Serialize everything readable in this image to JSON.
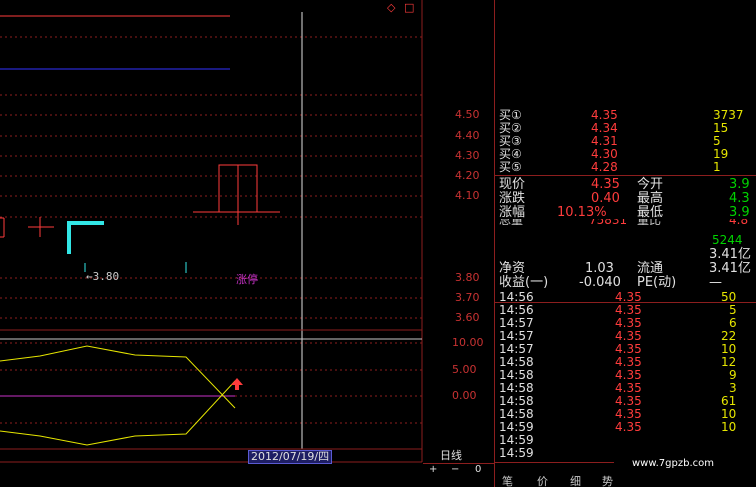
{
  "top_icons": {
    "restore": "◇",
    "window": "□"
  },
  "axis_upper": [
    "4.50",
    "4.40",
    "4.30",
    "4.20",
    "4.10"
  ],
  "axis_lower": [
    "3.80",
    "3.70",
    "3.60"
  ],
  "axis_indicator": [
    "10.00",
    "5.00",
    "0.00"
  ],
  "annotations": {
    "low_marker": "←3.80",
    "limit_up": "涨停"
  },
  "date_label": "2012/07/19/四",
  "period_label": "日线",
  "zoom": {
    "plus": "+",
    "minus": "−",
    "zero": "0"
  },
  "order_book": [
    {
      "label": "买①",
      "price": "4.35",
      "vol": "3737"
    },
    {
      "label": "买②",
      "price": "4.34",
      "vol": "15"
    },
    {
      "label": "买③",
      "price": "4.31",
      "vol": "5"
    },
    {
      "label": "买④",
      "price": "4.30",
      "vol": "19"
    },
    {
      "label": "买⑤",
      "price": "4.28",
      "vol": "1"
    }
  ],
  "stats": [
    {
      "l1": "现价",
      "v1": "4.35",
      "l2": "今开",
      "v2": "3.9"
    },
    {
      "l1": "涨跌",
      "v1": "0.40",
      "l2": "最高",
      "v2": "4.3"
    },
    {
      "l1": "涨幅",
      "v1": "10.13%",
      "l2": "最低",
      "v2": "3.9"
    }
  ],
  "partial_row": {
    "l1": "总量",
    "v1": "75831",
    "l2": "量比",
    "v2": "4.8"
  },
  "volume_right": "5244",
  "capital": [
    {
      "l1": "",
      "v1": "",
      "l2": "",
      "v2": "3.41亿"
    },
    {
      "l1": "净资",
      "v1": "1.03",
      "l2": "流通",
      "v2": "3.41亿"
    },
    {
      "l1": "收益(一)",
      "v1": "-0.040",
      "l2": "PE(动)",
      "v2": "—"
    }
  ],
  "ticks": [
    {
      "time": "14:56",
      "price": "4.35",
      "vol": "50"
    },
    {
      "time": "14:56",
      "price": "4.35",
      "vol": "5"
    },
    {
      "time": "14:57",
      "price": "4.35",
      "vol": "6"
    },
    {
      "time": "14:57",
      "price": "4.35",
      "vol": "22"
    },
    {
      "time": "14:57",
      "price": "4.35",
      "vol": "10"
    },
    {
      "time": "14:58",
      "price": "4.35",
      "vol": "12"
    },
    {
      "time": "14:58",
      "price": "4.35",
      "vol": "9"
    },
    {
      "time": "14:58",
      "price": "4.35",
      "vol": "3"
    },
    {
      "time": "14:58",
      "price": "4.35",
      "vol": "61"
    },
    {
      "time": "14:58",
      "price": "4.35",
      "vol": "10"
    },
    {
      "time": "14:59",
      "price": "4.35",
      "vol": "10"
    },
    {
      "time": "14:59",
      "price": "",
      "vol": ""
    },
    {
      "time": "14:59",
      "price": "",
      "vol": ""
    }
  ],
  "bottom_tabs": [
    "笔",
    "价",
    "细",
    "势"
  ],
  "watermark": "www.7gpzb.com",
  "colors": {
    "up": "#ff3c3c",
    "down": "#00d200",
    "ma": "#e6e600",
    "grid": "#8c1e1e",
    "accent": "#c832c8"
  }
}
